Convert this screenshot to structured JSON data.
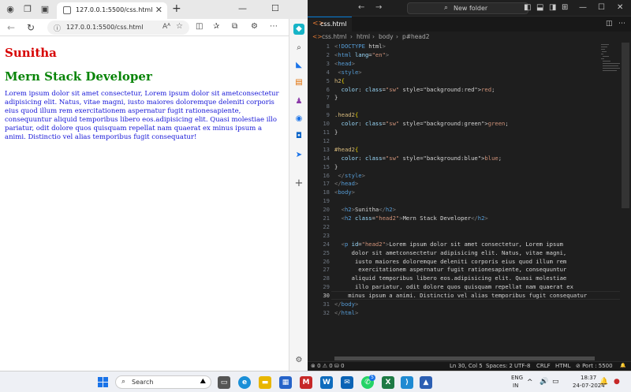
{
  "browser": {
    "tab": {
      "title": "127.0.0.1:5500/css.html",
      "close": "✕"
    },
    "new_tab": "+",
    "window_controls": {
      "minimize": "—",
      "maximize": "☐",
      "close": "✕"
    },
    "nav": {
      "back": "←",
      "reload": "↻"
    },
    "address": {
      "url": "127.0.0.1:5500/css.html",
      "read_aloud": "Aᴬ",
      "favorite": "☆"
    },
    "content": {
      "h2": "Sunitha",
      "h2_class": "Mern Stack Developer",
      "paragraph": "Lorem ipsum dolor sit amet consectetur, Lorem ipsum dolor sit ametconsectetur adipisicing elit. Natus, vitae magni, iusto maiores doloremque deleniti corporis eius quod illum rem exercitationem aspernatur fugit rationesapiente, consequuntur aliquid temporibus libero eos.adipisicing elit. Quasi molestiae illo pariatur, odit dolore quos quisquam repellat nam quaerat ex minus ipsum a animi. Distinctio vel alias temporibus fugit consequatur!"
    },
    "sidebar": {
      "add": "+"
    },
    "colors": {
      "h2": "#d70000",
      "head2_class": "#078407",
      "head2_id": "#1717d7"
    }
  },
  "vscode": {
    "title_bar": {
      "back": "←",
      "forward": "→",
      "search": "New folder"
    },
    "tab": {
      "label": "css.html",
      "icon": "<>",
      "close": "✕"
    },
    "breadcrumb": {
      "file": "css.html",
      "html": "html",
      "body": "body",
      "element": "p#head2"
    },
    "code_lines": [
      "<!DOCTYPE html>",
      "<html lang=\"en\">",
      "<head>",
      " <style>",
      "h2{",
      "  color: ▪red;",
      "}",
      "",
      ".head2{",
      "  color: ▪green;",
      "}",
      "",
      "#head2{",
      "  color: ▪blue;",
      "}",
      " </style>",
      "</head>",
      "<body>",
      "",
      "  <h2>Sunitha</h2>",
      "  <h2 class=\"head2\">Mern Stack Developer</h2>",
      "",
      "",
      "  <p id=\"head2\">Lorem ipsum dolor sit amet consectetur, Lorem ipsum",
      "     dolor sit ametconsectetur adipisicing elit. Natus, vitae magni,",
      "      iusto maiores doloremque deleniti corporis eius quod illum rem",
      "       exercitationem aspernatur fugit rationesapiente, consequuntur",
      "     aliquid temporibus libero eos.adipisicing elit. Quasi molestiae",
      "      illo pariatur, odit dolore quos quisquam repellat nam quaerat ex",
      "    minus ipsum a animi. Distinctio vel alias temporibus fugit consequatur",
      "</body>",
      "</html>"
    ],
    "current_line": 30,
    "status": {
      "errors": "⊗ 0 ⚠ 0",
      "ports": "⛁ 0",
      "position": "Ln 30, Col 5",
      "spaces": "Spaces: 2",
      "encoding": "UTF-8",
      "eol": "CRLF",
      "language": "HTML",
      "port": "⊘ Port : 5500",
      "bell": "🔔"
    }
  },
  "taskbar": {
    "search_placeholder": "Search",
    "badge_count": "5",
    "language": "ENG",
    "region": "IN",
    "time": "18:37",
    "date": "24-07-2024"
  }
}
